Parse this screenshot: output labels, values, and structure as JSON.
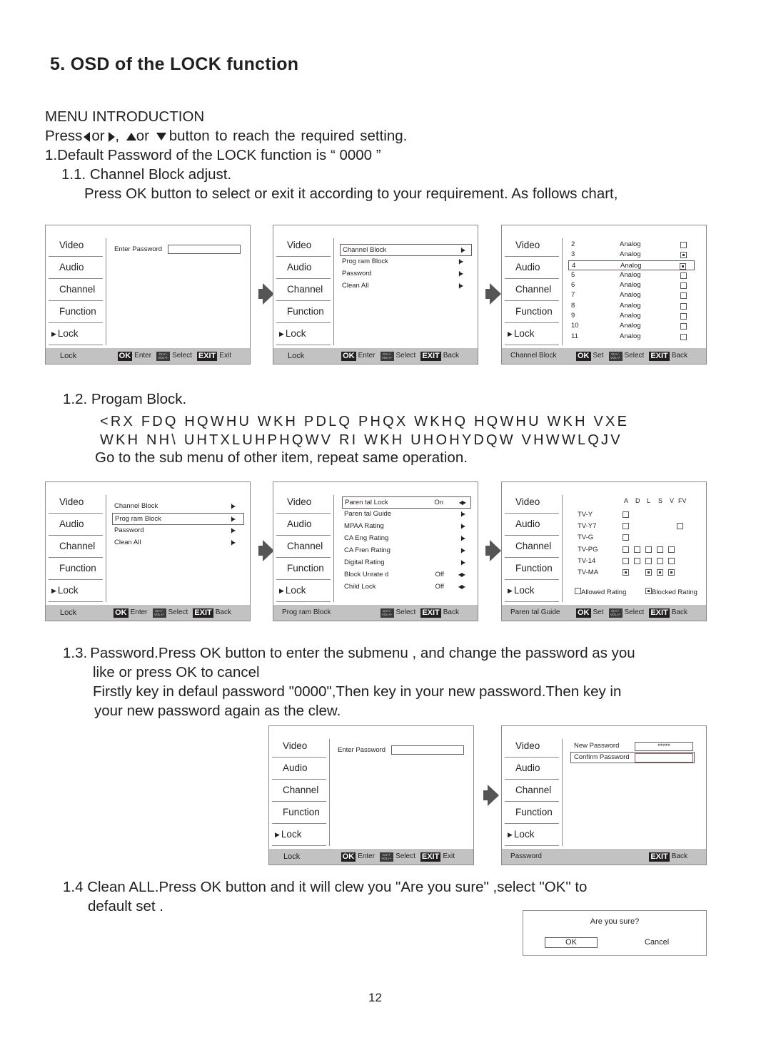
{
  "doc": {
    "title": "5. OSD of the LOCK function",
    "menu_intro": "MENU INTRODUCTION",
    "press_line": {
      "a": "Press",
      "or1": "or",
      "comma": ",",
      "or2": "or",
      "rest": "button  to  reach  the  required  setting."
    },
    "default_pw": "1.Default Password of the LOCK function is “ 0000 ”",
    "s11_head": "1.1. Channel Block adjust.",
    "s11_body": "Press OK button to select or exit it according to your requirement. As follows chart,",
    "s12_head": "1.2. Progam Block.",
    "s12_garbled_1": "<RX FDQ HQWHU WKH PDLQ PHQX  WKHQ HQWHU WKH VXE",
    "s12_garbled_2": "WKH NH\\ UHTXLUHPHQWV RI WKH UHOHYDQW VHWWLQJV",
    "s12_body": "Go to the sub menu of other item, repeat same operation.",
    "s13_num": "1.3.",
    "s13_line1": "Password.Press OK button to enter the submenu , and change the password as you",
    "s13_line2": "like or press OK to cancel",
    "s13_line3": "Firstly key in defaul password \"0000\",Then key in your new password.Then key in",
    "s13_line4": "your new password again as the clew.",
    "s14_line1": "1.4 Clean ALL.Press OK button and it will clew you  \"Are you sure\" ,select \"OK\" to",
    "s14_line2": "default set .",
    "page_number": "12"
  },
  "menu": [
    "Video",
    "Audio",
    "Channel",
    "Function",
    "Lock"
  ],
  "menu_pointer": "▶",
  "keys": {
    "ok": "OK",
    "exit": "EXIT",
    "chvol": "CH+/- VOL+/-",
    "enter": "Enter",
    "select": "Select",
    "exit_label": "Exit",
    "back": "Back",
    "set": "Set"
  },
  "panels": {
    "enter_password": {
      "label": "Enter  Password",
      "footer": "Lock",
      "value": ""
    },
    "lock_submenu": {
      "items": [
        "Channel  Block",
        "Prog ram  Block",
        "Password",
        "Clean  All"
      ],
      "footer": "Lock"
    },
    "channel_block": {
      "footer": "Channel  Block",
      "channels": [
        {
          "num": "2",
          "type": "Analog",
          "blocked": false
        },
        {
          "num": "3",
          "type": "Analog",
          "blocked": true
        },
        {
          "num": "4",
          "type": "Analog",
          "blocked": true,
          "selected": true
        },
        {
          "num": "5",
          "type": "Analog",
          "blocked": false
        },
        {
          "num": "6",
          "type": "Analog",
          "blocked": false
        },
        {
          "num": "7",
          "type": "Analog",
          "blocked": false
        },
        {
          "num": "8",
          "type": "Analog",
          "blocked": false
        },
        {
          "num": "9",
          "type": "Analog",
          "blocked": false
        },
        {
          "num": "10",
          "type": "Analog",
          "blocked": false
        },
        {
          "num": "11",
          "type": "Analog",
          "blocked": false
        }
      ]
    },
    "program_block": {
      "footer": "Prog ram  Block",
      "items": [
        {
          "label": "Paren tal   Lock",
          "value": "On",
          "arrow": "lr"
        },
        {
          "label": "Paren tal  Guide",
          "value": "",
          "arrow": "sub"
        },
        {
          "label": "MPAA  Rating",
          "value": "",
          "arrow": "sub"
        },
        {
          "label": "CA  Eng  Rating",
          "value": "",
          "arrow": "sub"
        },
        {
          "label": "CA  Fren  Rating",
          "value": "",
          "arrow": "sub"
        },
        {
          "label": "Digital  Rating",
          "value": "",
          "arrow": "sub"
        },
        {
          "label": "Block  Unrate d",
          "value": "Off",
          "arrow": "lr"
        },
        {
          "label": "Child  Lock",
          "value": "Off",
          "arrow": "lr"
        }
      ]
    },
    "parental_guide": {
      "footer": "Paren tal  Guide",
      "columns": [
        "A",
        "D",
        "L",
        "S",
        "V",
        "FV"
      ],
      "rows": [
        {
          "label": "TV-Y",
          "cells": [
            "allowed",
            "",
            "",
            "",
            "",
            ""
          ]
        },
        {
          "label": "TV-Y7",
          "cells": [
            "allowed",
            "",
            "",
            "",
            "",
            "allowed"
          ]
        },
        {
          "label": "TV-G",
          "cells": [
            "allowed",
            "",
            "",
            "",
            "",
            ""
          ]
        },
        {
          "label": "TV-PG",
          "cells": [
            "allowed",
            "allowed",
            "allowed",
            "allowed",
            "allowed",
            ""
          ]
        },
        {
          "label": "TV-14",
          "cells": [
            "allowed",
            "allowed",
            "allowed",
            "allowed",
            "allowed",
            ""
          ]
        },
        {
          "label": "TV-MA",
          "cells": [
            "blocked",
            "",
            "blocked",
            "blocked",
            "blocked",
            ""
          ]
        }
      ],
      "legend_allowed": "Allowed  Rating",
      "legend_blocked": "Blocked  Rating"
    },
    "new_password": {
      "new_label": "New  Password",
      "new_value": "*****",
      "confirm_label": "Confirm  Password",
      "confirm_value": "",
      "footer": "Password"
    }
  },
  "dialog": {
    "question": "Are  you  sure?",
    "ok": "OK",
    "cancel": "Cancel"
  }
}
